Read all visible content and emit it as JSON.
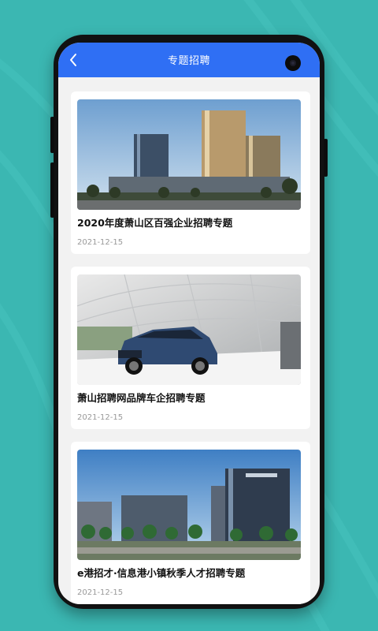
{
  "header": {
    "title": "专题招聘",
    "back_icon": "chevron-left-icon",
    "background_color": "#2f6ff4"
  },
  "topics": [
    {
      "title": "2020年度萧山区百强企业招聘专题",
      "date": "2021-12-15",
      "image": "office-towers-photo"
    },
    {
      "title": "萧山招聘网品牌车企招聘专题",
      "date": "2021-12-15",
      "image": "suv-car-photo"
    },
    {
      "title": "e港招才·信息港小镇秋季人才招聘专题",
      "date": "2021-12-15",
      "image": "tech-park-photo"
    }
  ]
}
